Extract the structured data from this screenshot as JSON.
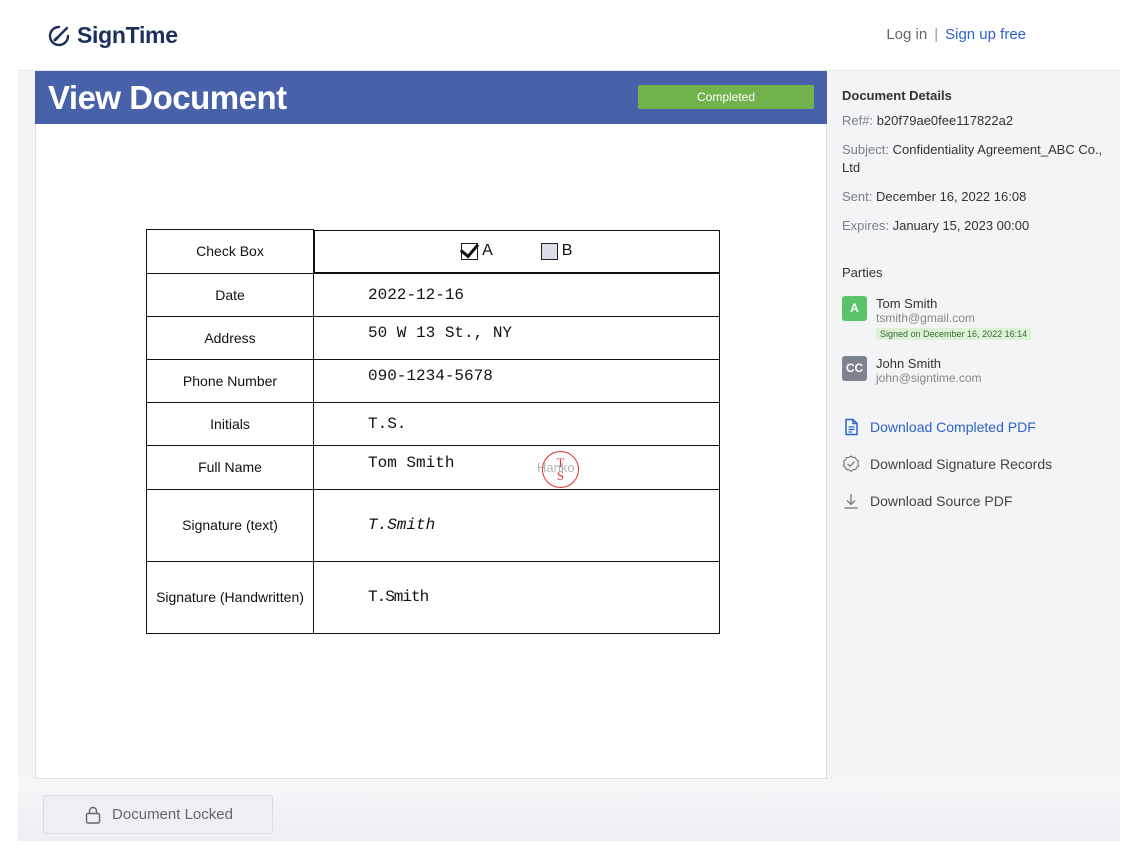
{
  "header": {
    "logo_text": "SignTime",
    "login": "Log in",
    "separator": "|",
    "signup": "Sign up free"
  },
  "document": {
    "title": "View Document",
    "status": "Completed",
    "status_color": "#72b24d",
    "header_color": "#4862aa",
    "rows": {
      "check_box": {
        "label": "Check Box",
        "option_a": "A",
        "option_b": "B",
        "a_checked": true,
        "b_checked": false
      },
      "date": {
        "label": "Date",
        "value": "2022-12-16"
      },
      "address": {
        "label": "Address",
        "value": "50 W 13 St., NY"
      },
      "phone": {
        "label": "Phone Number",
        "value": "090-1234-5678"
      },
      "initials": {
        "label": "Initials",
        "value": "T.S."
      },
      "full_name": {
        "label": "Full Name",
        "value": "Tom Smith",
        "stamp_top": "T",
        "stamp_bottom": "S",
        "stamp_overlay": "Hanko"
      },
      "signature_text": {
        "label": "Signature (text)",
        "value": "T.Smith"
      },
      "signature_hand": {
        "label": "Signature (Handwritten)",
        "value": "T.Smith"
      }
    }
  },
  "sidebar": {
    "details_title": "Document Details",
    "ref_key": "Ref#:",
    "ref_value": "b20f79ae0fee117822a2",
    "subject_key": "Subject:",
    "subject_value": "Confidentiality Agreement_ABC Co., Ltd",
    "sent_key": "Sent:",
    "sent_value": "December 16, 2022 16:08",
    "expires_key": "Expires:",
    "expires_value": "January 15, 2023 00:00",
    "parties_title": "Parties",
    "parties": [
      {
        "badge": "A",
        "name": "Tom Smith",
        "email": "tsmith@gmail.com",
        "status": "Signed on December 16, 2022 16:14"
      },
      {
        "badge": "CC",
        "name": "John Smith",
        "email": "john@signtime.com"
      }
    ],
    "actions": {
      "download_completed": "Download Completed PDF",
      "download_records": "Download Signature Records",
      "download_source": "Download Source PDF"
    }
  },
  "footer": {
    "locked_label": "Document Locked"
  }
}
